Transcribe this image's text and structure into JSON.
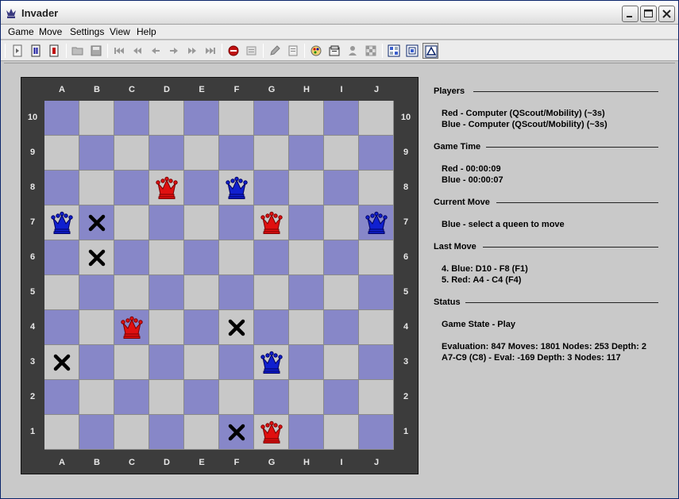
{
  "window": {
    "title": "Invader"
  },
  "menu": [
    "Game",
    "Move",
    "Settings",
    "View",
    "Help"
  ],
  "toolbar": {
    "buttons": [
      "play-icon",
      "pause-icon",
      "stop-icon",
      "open-icon",
      "save-icon",
      "first-move-icon",
      "back-fast-icon",
      "back-icon",
      "forward-icon",
      "forward-fast-icon",
      "last-move-icon",
      "resign-icon",
      "hint-icon",
      "edit-icon",
      "notes-icon",
      "palette-icon",
      "settings-icon",
      "player-icon",
      "board-icon",
      "grid-icon",
      "target-icon",
      "mobility-icon"
    ],
    "active": "mobility-icon"
  },
  "board": {
    "files": [
      "A",
      "B",
      "C",
      "D",
      "E",
      "F",
      "G",
      "H",
      "I",
      "J"
    ],
    "ranks": [
      "10",
      "9",
      "8",
      "7",
      "6",
      "5",
      "4",
      "3",
      "2",
      "1"
    ],
    "pieces": [
      {
        "square": "D8",
        "type": "red-queen"
      },
      {
        "square": "F8",
        "type": "blue-queen"
      },
      {
        "square": "A7",
        "type": "blue-queen"
      },
      {
        "square": "B7",
        "type": "arrow"
      },
      {
        "square": "G7",
        "type": "red-queen"
      },
      {
        "square": "J7",
        "type": "blue-queen"
      },
      {
        "square": "B6",
        "type": "arrow"
      },
      {
        "square": "C4",
        "type": "red-queen"
      },
      {
        "square": "F4",
        "type": "arrow"
      },
      {
        "square": "A3",
        "type": "arrow"
      },
      {
        "square": "G3",
        "type": "blue-queen"
      },
      {
        "square": "F1",
        "type": "arrow"
      },
      {
        "square": "G1",
        "type": "red-queen"
      }
    ],
    "colors": {
      "dark": "#8787c8",
      "light": "#c8c8c8",
      "red": "#e01010",
      "blue": "#1020d0"
    }
  },
  "info": {
    "players": {
      "heading": "Players",
      "red": "Red  - Computer (QScout/Mobility) (~3s)",
      "blue": "Blue - Computer (QScout/Mobility) (~3s)"
    },
    "game_time": {
      "heading": "Game Time",
      "red": "Red  - 00:00:09",
      "blue": "Blue - 00:00:07"
    },
    "current_move": {
      "heading": "Current Move",
      "text": "Blue - select a queen to move"
    },
    "last_move": {
      "heading": "Last Move",
      "line1": "4. Blue: D10 - F8 (F1)",
      "line2": "5. Red: A4 - C4 (F4)"
    },
    "status": {
      "heading": "Status",
      "state": "Game State - Play",
      "eval1": "Evaluation: 847 Moves: 1801 Nodes: 253 Depth: 2",
      "eval2": "A7-C9 (C8) - Eval: -169 Depth: 3 Nodes: 117"
    }
  }
}
